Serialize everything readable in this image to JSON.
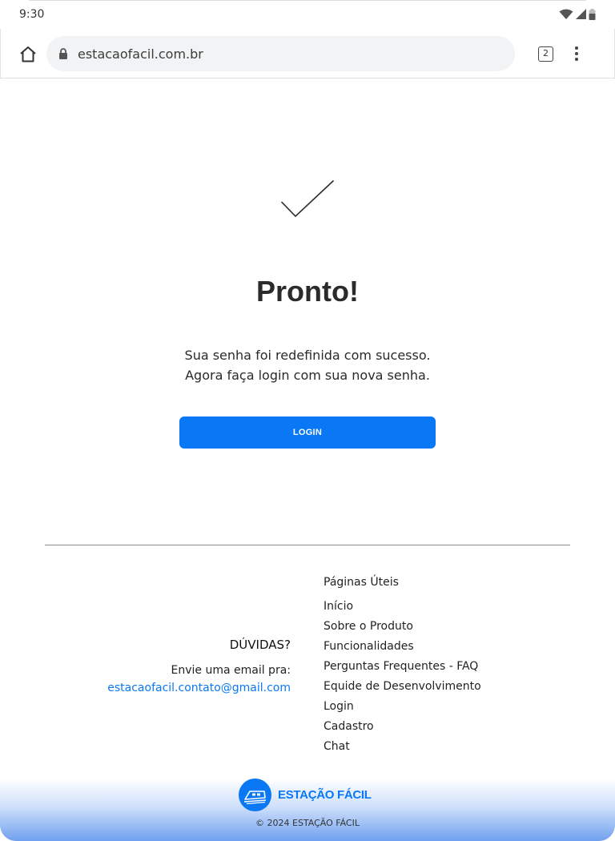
{
  "status_bar": {
    "time": "9:30"
  },
  "browser": {
    "url": "estacaofacil.com.br",
    "tab_count": "2"
  },
  "main": {
    "title": "Pronto!",
    "message_line1": "Sua senha foi redefinida com sucesso.",
    "message_line2": "Agora faça login com sua nova senha.",
    "login_button": "LOGIN"
  },
  "footer": {
    "faq_title": "DÚVIDAS?",
    "faq_text": "Envie uma email pra:",
    "faq_email": "estacaofacil.contato@gmail.com",
    "links_title": "Páginas Úteis",
    "links": [
      "Início",
      "Sobre o Produto",
      "Funcionalidades",
      "Perguntas Frequentes - FAQ",
      "Equide de Desenvolvimento",
      "Login",
      "Cadastro",
      "Chat"
    ],
    "brand_name": "ESTAÇÃO FÁCIL",
    "copyright": "© 2024 ESTAÇÃO FÁCIL"
  },
  "colors": {
    "accent": "#0a78f5",
    "footer_gradient_end": "#6fa0ef"
  },
  "icons": {
    "status": [
      "wifi-icon",
      "signal-icon",
      "battery-icon"
    ],
    "toolbar": [
      "home-icon",
      "lock-icon",
      "tabs-icon",
      "more-vert-icon"
    ],
    "content": [
      "checkmark-icon",
      "train-logo-icon"
    ]
  }
}
